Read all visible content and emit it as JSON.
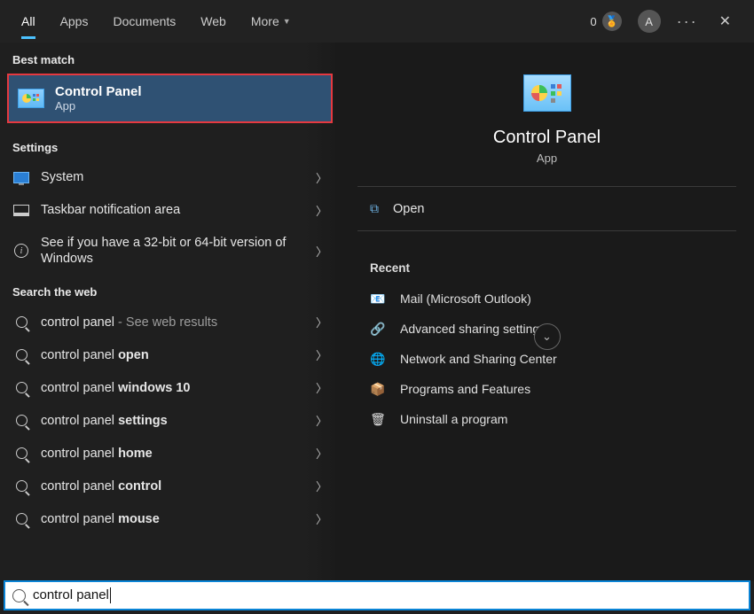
{
  "tabs": {
    "all": "All",
    "apps": "Apps",
    "documents": "Documents",
    "web": "Web",
    "more": "More"
  },
  "top_right": {
    "points": "0",
    "avatar_letter": "A"
  },
  "left": {
    "best_match_header": "Best match",
    "best_match": {
      "title": "Control Panel",
      "subtitle": "App"
    },
    "settings_header": "Settings",
    "settings": [
      {
        "label": "System"
      },
      {
        "label": "Taskbar notification area"
      },
      {
        "label": "See if you have a 32-bit or 64-bit version of Windows"
      }
    ],
    "web_header": "Search the web",
    "web_results": [
      {
        "prefix": "control panel",
        "bold": "",
        "suffix": " - See web results"
      },
      {
        "prefix": "control panel ",
        "bold": "open",
        "suffix": ""
      },
      {
        "prefix": "control panel ",
        "bold": "windows 10",
        "suffix": ""
      },
      {
        "prefix": "control panel ",
        "bold": "settings",
        "suffix": ""
      },
      {
        "prefix": "control panel ",
        "bold": "home",
        "suffix": ""
      },
      {
        "prefix": "control panel ",
        "bold": "control",
        "suffix": ""
      },
      {
        "prefix": "control panel ",
        "bold": "mouse",
        "suffix": ""
      }
    ]
  },
  "preview": {
    "title": "Control Panel",
    "subtitle": "App",
    "open_label": "Open",
    "recent_header": "Recent",
    "recent": [
      "Mail (Microsoft Outlook)",
      "Advanced sharing settings",
      "Network and Sharing Center",
      "Programs and Features",
      "Uninstall a program"
    ]
  },
  "search": {
    "query": "control panel"
  }
}
